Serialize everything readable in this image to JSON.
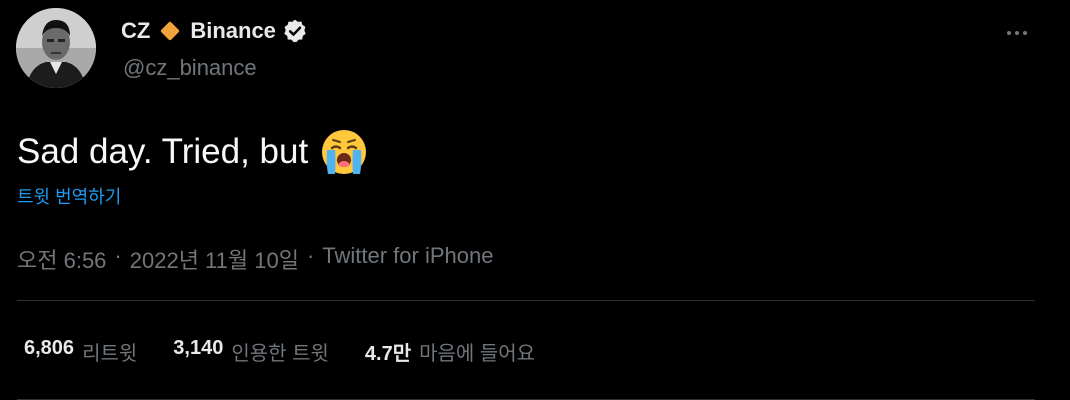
{
  "author": {
    "name": "CZ",
    "org_name": "Binance",
    "handle": "@cz_binance",
    "avatar_icon": "profile-photo",
    "diamond_icon": "orange-diamond-icon",
    "verified_icon": "verified-badge-icon"
  },
  "more_icon": "more-horizontal-icon",
  "tweet": {
    "text": "Sad day. Tried, but",
    "emoji": "loudly-crying-face",
    "translate_label": "트윗 번역하기"
  },
  "meta": {
    "time": "오전 6:56",
    "sep1": "·",
    "date": "2022년 11월 10일",
    "sep2": "·",
    "source": "Twitter for iPhone"
  },
  "stats": {
    "retweets": {
      "value": "6,806",
      "label": "리트윗"
    },
    "quotes": {
      "value": "3,140",
      "label": "인용한 트윗"
    },
    "likes": {
      "value": "4.7만",
      "label": "마음에 들어요"
    }
  },
  "colors": {
    "background": "#000000",
    "text": "#e7e9ea",
    "muted": "#71767b",
    "link": "#1d9bf0",
    "binance": "#f0a23b",
    "divider": "#2f3336"
  }
}
